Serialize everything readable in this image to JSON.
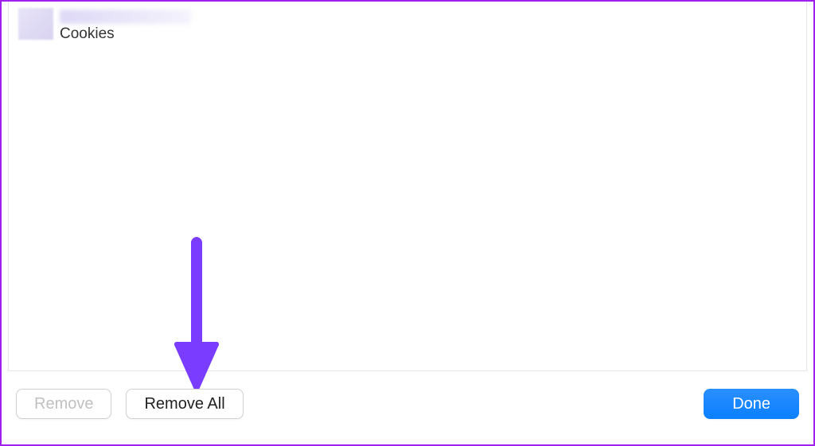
{
  "list": {
    "items": [
      {
        "subtitle": "Cookies"
      }
    ]
  },
  "buttons": {
    "remove": "Remove",
    "removeAll": "Remove All",
    "done": "Done"
  },
  "annotation": {
    "arrowColor": "#7a3cff"
  }
}
